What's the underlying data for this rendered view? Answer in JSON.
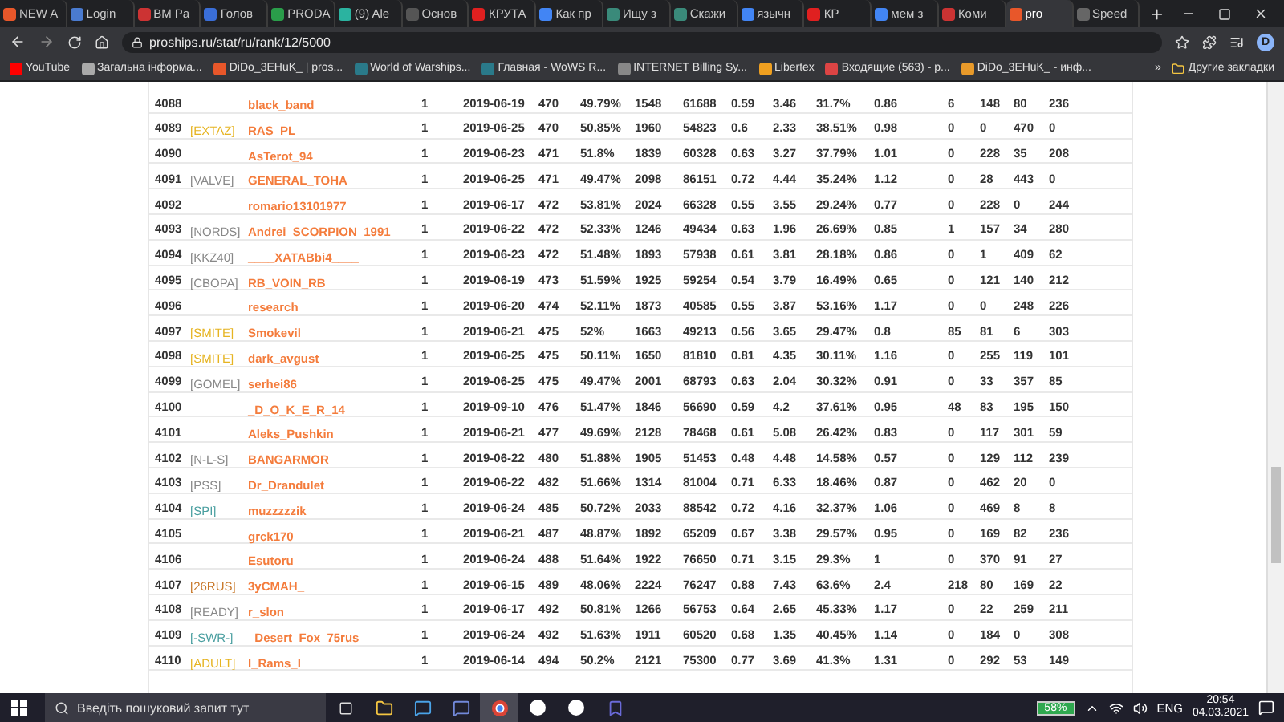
{
  "browser": {
    "tabs": [
      {
        "title": "NEW A",
        "selected": false
      },
      {
        "title": "Login",
        "selected": false
      },
      {
        "title": "BM Pa",
        "selected": false
      },
      {
        "title": "Голов",
        "selected": false
      },
      {
        "title": "PRODA",
        "selected": false
      },
      {
        "title": "(9) Ale",
        "selected": false
      },
      {
        "title": "Основ",
        "selected": false
      },
      {
        "title": "КРУТА",
        "selected": false
      },
      {
        "title": "Как пр",
        "selected": false
      },
      {
        "title": "Ищу з",
        "selected": false
      },
      {
        "title": "Скажи",
        "selected": false
      },
      {
        "title": "язычн",
        "selected": false
      },
      {
        "title": "КР",
        "selected": false
      },
      {
        "title": "мем з",
        "selected": false
      },
      {
        "title": "Коми",
        "selected": false
      },
      {
        "title": "pro",
        "selected": true
      },
      {
        "title": "Speed",
        "selected": false
      }
    ],
    "address": "proships.ru/stat/ru/rank/12/5000",
    "profile": "D",
    "bookmarks": [
      "YouTube",
      "Загальна інформа...",
      "DiDo_3EHuK_ | pros...",
      "World of Warships...",
      "Главная - WoWS R...",
      "INTERNET Billing Sy...",
      "Libertex",
      "Входящие (563) - p...",
      "DiDo_3EHuK_ - инф..."
    ],
    "more_bookmarks": "»",
    "other_bookmarks": "Другие закладки"
  },
  "table": {
    "rows": [
      {
        "rank": "4088",
        "player": "black_band",
        "values": [
          "1",
          "2019-06-19",
          "470",
          "49.79%",
          "1548",
          "61688",
          "0.59",
          "3.46",
          "31.7%",
          "0.86",
          "6",
          "148",
          "80",
          "236"
        ]
      },
      {
        "rank": "4089",
        "clan": {
          "tag": "[EXTAZ]",
          "color": "#e6b422"
        },
        "player": "RAS_PL",
        "values": [
          "1",
          "2019-06-25",
          "470",
          "50.85%",
          "1960",
          "54823",
          "0.6",
          "2.33",
          "38.51%",
          "0.98",
          "0",
          "0",
          "470",
          "0"
        ]
      },
      {
        "rank": "4090",
        "player": "AsTerot_94",
        "values": [
          "1",
          "2019-06-23",
          "471",
          "51.8%",
          "1839",
          "60328",
          "0.63",
          "3.27",
          "37.79%",
          "1.01",
          "0",
          "228",
          "35",
          "208"
        ]
      },
      {
        "rank": "4091",
        "clan": {
          "tag": "[VALVE]",
          "color": "#888888"
        },
        "player": "GENERAL_TOHA",
        "values": [
          "1",
          "2019-06-25",
          "471",
          "49.47%",
          "2098",
          "86151",
          "0.72",
          "4.44",
          "35.24%",
          "1.12",
          "0",
          "28",
          "443",
          "0"
        ]
      },
      {
        "rank": "4092",
        "player": "romario13101977",
        "values": [
          "1",
          "2019-06-17",
          "472",
          "53.81%",
          "2024",
          "66328",
          "0.55",
          "3.55",
          "29.24%",
          "0.77",
          "0",
          "228",
          "0",
          "244"
        ]
      },
      {
        "rank": "4093",
        "clan": {
          "tag": "[NORDS]",
          "color": "#888888"
        },
        "player": "Andrei_SCORPION_1991_",
        "values": [
          "1",
          "2019-06-22",
          "472",
          "52.33%",
          "1246",
          "49434",
          "0.63",
          "1.96",
          "26.69%",
          "0.85",
          "1",
          "157",
          "34",
          "280"
        ]
      },
      {
        "rank": "4094",
        "clan": {
          "tag": "[KKZ40]",
          "color": "#888888"
        },
        "player": "____XATABbi4____",
        "values": [
          "1",
          "2019-06-23",
          "472",
          "51.48%",
          "1893",
          "57938",
          "0.61",
          "3.81",
          "28.18%",
          "0.86",
          "0",
          "1",
          "409",
          "62"
        ]
      },
      {
        "rank": "4095",
        "clan": {
          "tag": "[CBOPA]",
          "color": "#888888"
        },
        "player": "RB_VOIN_RB",
        "values": [
          "1",
          "2019-06-19",
          "473",
          "51.59%",
          "1925",
          "59254",
          "0.54",
          "3.79",
          "16.49%",
          "0.65",
          "0",
          "121",
          "140",
          "212"
        ]
      },
      {
        "rank": "4096",
        "player": "research",
        "values": [
          "1",
          "2019-06-20",
          "474",
          "52.11%",
          "1873",
          "40585",
          "0.55",
          "3.87",
          "53.16%",
          "1.17",
          "0",
          "0",
          "248",
          "226"
        ]
      },
      {
        "rank": "4097",
        "clan": {
          "tag": "[SMITE]",
          "color": "#e6b422"
        },
        "player": "Smokevil",
        "values": [
          "1",
          "2019-06-21",
          "475",
          "52%",
          "1663",
          "49213",
          "0.56",
          "3.65",
          "29.47%",
          "0.8",
          "85",
          "81",
          "6",
          "303"
        ]
      },
      {
        "rank": "4098",
        "clan": {
          "tag": "[SMITE]",
          "color": "#e6b422"
        },
        "player": "dark_avgust",
        "values": [
          "1",
          "2019-06-25",
          "475",
          "50.11%",
          "1650",
          "81810",
          "0.81",
          "4.35",
          "30.11%",
          "1.16",
          "0",
          "255",
          "119",
          "101"
        ]
      },
      {
        "rank": "4099",
        "clan": {
          "tag": "[GOMEL]",
          "color": "#888888"
        },
        "player": "serhei86",
        "values": [
          "1",
          "2019-06-25",
          "475",
          "49.47%",
          "2001",
          "68793",
          "0.63",
          "2.04",
          "30.32%",
          "0.91",
          "0",
          "33",
          "357",
          "85"
        ]
      },
      {
        "rank": "4100",
        "player": "_D_O_K_E_R_14",
        "values": [
          "1",
          "2019-09-10",
          "476",
          "51.47%",
          "1846",
          "56690",
          "0.59",
          "4.2",
          "37.61%",
          "0.95",
          "48",
          "83",
          "195",
          "150"
        ]
      },
      {
        "rank": "4101",
        "player": "Aleks_Pushkin",
        "values": [
          "1",
          "2019-06-21",
          "477",
          "49.69%",
          "2128",
          "78468",
          "0.61",
          "5.08",
          "26.42%",
          "0.83",
          "0",
          "117",
          "301",
          "59"
        ]
      },
      {
        "rank": "4102",
        "clan": {
          "tag": "[N-L-S]",
          "color": "#888888"
        },
        "player": "BANGARMOR",
        "values": [
          "1",
          "2019-06-22",
          "480",
          "51.88%",
          "1905",
          "51453",
          "0.48",
          "4.48",
          "14.58%",
          "0.57",
          "0",
          "129",
          "112",
          "239"
        ]
      },
      {
        "rank": "4103",
        "clan": {
          "tag": "[PSS]",
          "color": "#888888"
        },
        "player": "Dr_Drandulet",
        "values": [
          "1",
          "2019-06-22",
          "482",
          "51.66%",
          "1314",
          "81004",
          "0.71",
          "6.33",
          "18.46%",
          "0.87",
          "0",
          "462",
          "20",
          "0"
        ]
      },
      {
        "rank": "4104",
        "clan": {
          "tag": "[SPI]",
          "color": "#4a9fa0"
        },
        "player": "muzzzzzik",
        "values": [
          "1",
          "2019-06-24",
          "485",
          "50.72%",
          "2033",
          "88542",
          "0.72",
          "4.16",
          "32.37%",
          "1.06",
          "0",
          "469",
          "8",
          "8"
        ]
      },
      {
        "rank": "4105",
        "player": "grck170",
        "values": [
          "1",
          "2019-06-21",
          "487",
          "48.87%",
          "1892",
          "65209",
          "0.67",
          "3.38",
          "29.57%",
          "0.95",
          "0",
          "169",
          "82",
          "236"
        ]
      },
      {
        "rank": "4106",
        "player": "Esutoru_",
        "values": [
          "1",
          "2019-06-24",
          "488",
          "51.64%",
          "1922",
          "76650",
          "0.71",
          "3.15",
          "29.3%",
          "1",
          "0",
          "370",
          "91",
          "27"
        ]
      },
      {
        "rank": "4107",
        "clan": {
          "tag": "[26RUS]",
          "color": "#c8782a"
        },
        "player": "3yCMAH_",
        "values": [
          "1",
          "2019-06-15",
          "489",
          "48.06%",
          "2224",
          "76247",
          "0.88",
          "7.43",
          "63.6%",
          "2.4",
          "218",
          "80",
          "169",
          "22"
        ]
      },
      {
        "rank": "4108",
        "clan": {
          "tag": "[READY]",
          "color": "#888888"
        },
        "player": "r_slon",
        "values": [
          "1",
          "2019-06-17",
          "492",
          "50.81%",
          "1266",
          "56753",
          "0.64",
          "2.65",
          "45.33%",
          "1.17",
          "0",
          "22",
          "259",
          "211"
        ]
      },
      {
        "rank": "4109",
        "clan": {
          "tag": "[-SWR-]",
          "color": "#4a9fa0"
        },
        "player": "_Desert_Fox_75rus",
        "values": [
          "1",
          "2019-06-24",
          "492",
          "51.63%",
          "1911",
          "60520",
          "0.68",
          "1.35",
          "40.45%",
          "1.14",
          "0",
          "184",
          "0",
          "308"
        ]
      },
      {
        "rank": "4110",
        "clan": {
          "tag": "[ADULT]",
          "color": "#e6b422"
        },
        "player": "I_Rams_I",
        "values": [
          "1",
          "2019-06-14",
          "494",
          "50.2%",
          "2121",
          "75300",
          "0.77",
          "3.69",
          "41.3%",
          "1.31",
          "0",
          "292",
          "53",
          "149"
        ]
      }
    ]
  },
  "taskbar": {
    "search_placeholder": "Введіть пошуковий запит тут",
    "battery": "58%",
    "language": "ENG",
    "time": "20:54",
    "date": "04.03.2021"
  }
}
